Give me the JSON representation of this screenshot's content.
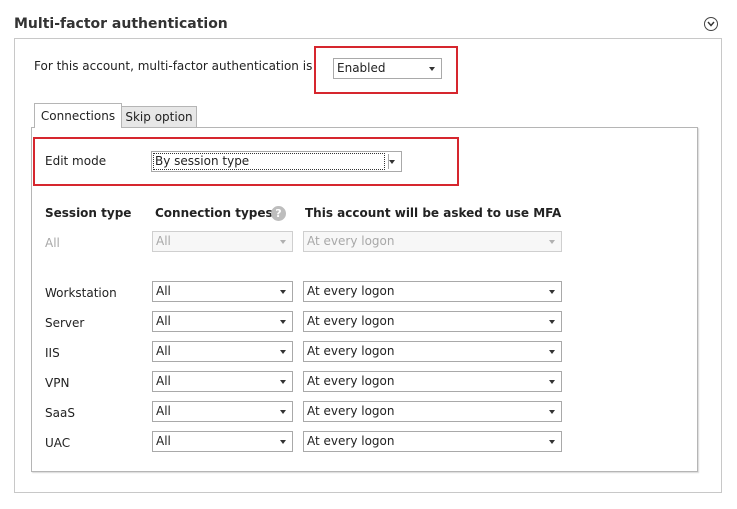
{
  "section": {
    "title": "Multi-factor authentication"
  },
  "account": {
    "label": "For this account, multi-factor authentication is",
    "value": "Enabled"
  },
  "tabs": [
    {
      "label": "Connections"
    },
    {
      "label": "Skip option"
    }
  ],
  "edit_mode": {
    "label": "Edit mode",
    "value": "By session type"
  },
  "columns": {
    "session_type": "Session type",
    "connection_types": "Connection types",
    "mfa": "This account will be asked to use MFA"
  },
  "rows": [
    {
      "session": "All",
      "connection": "All",
      "mfa": "At every logon",
      "disabled": true
    },
    {
      "session": "Workstation",
      "connection": "All",
      "mfa": "At every logon"
    },
    {
      "session": "Server",
      "connection": "All",
      "mfa": "At every logon"
    },
    {
      "session": "IIS",
      "connection": "All",
      "mfa": "At every logon"
    },
    {
      "session": "VPN",
      "connection": "All",
      "mfa": "At every logon"
    },
    {
      "session": "SaaS",
      "connection": "All",
      "mfa": "At every logon"
    },
    {
      "session": "UAC",
      "connection": "All",
      "mfa": "At every logon"
    }
  ],
  "colors": {
    "highlight": "#d6262e",
    "disabled_text": "#a8a8a8"
  },
  "icons": {
    "collapse": "chevron-circle-icon",
    "help": "help-icon"
  }
}
